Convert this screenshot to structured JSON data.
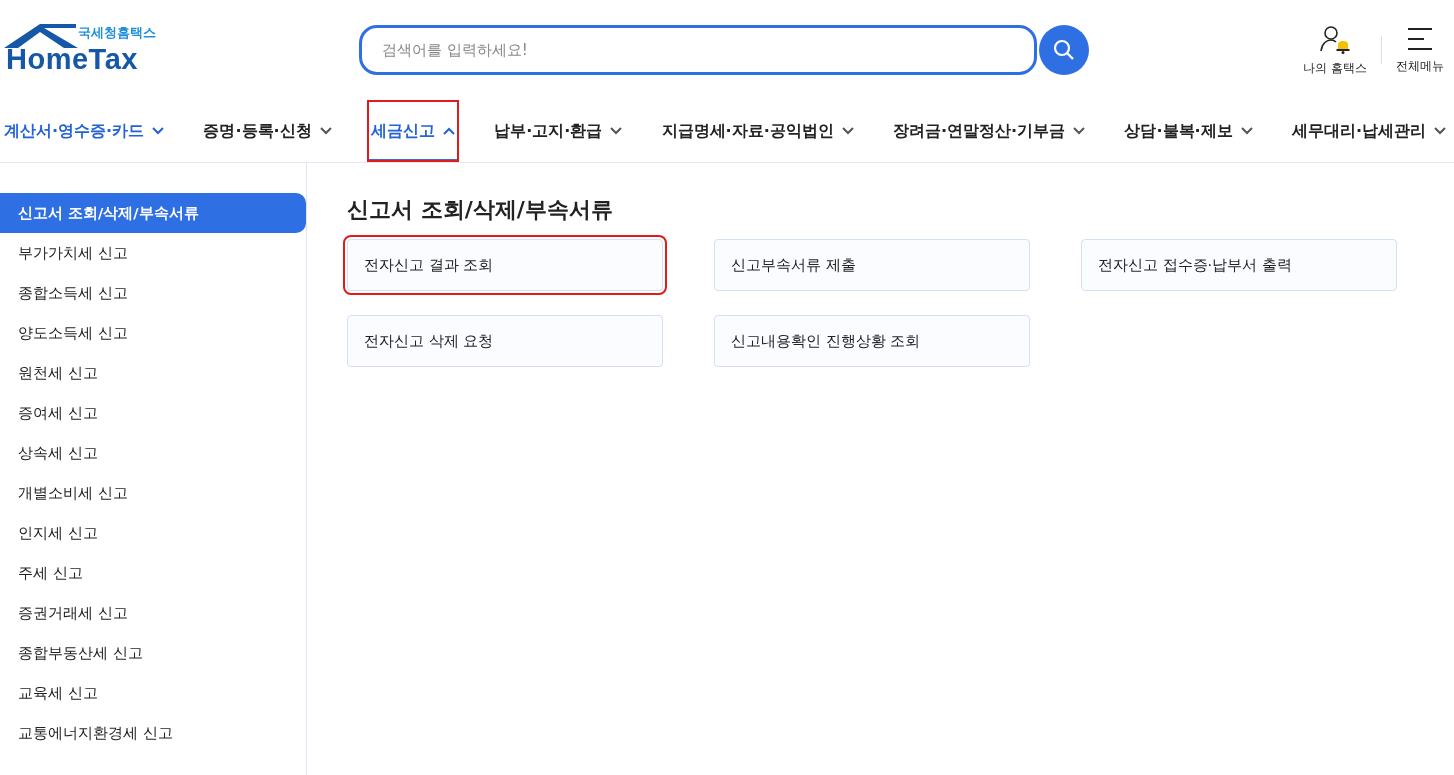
{
  "logo": {
    "subtitle": "국세청홈택스",
    "title": "HomeTax"
  },
  "search": {
    "placeholder": "검색어를 입력하세요!"
  },
  "utility": [
    {
      "kind": "user",
      "label": "나의 홈택스"
    },
    {
      "kind": "menu",
      "label": "전체메뉴"
    }
  ],
  "nav": [
    {
      "label": "계산서·영수증·카드",
      "selected": false,
      "hovered": true,
      "highlighted": false
    },
    {
      "label": "증명·등록·신청",
      "selected": false,
      "hovered": false,
      "highlighted": false
    },
    {
      "label": "세금신고",
      "selected": true,
      "hovered": false,
      "highlighted": true
    },
    {
      "label": "납부·고지·환급",
      "selected": false,
      "hovered": false,
      "highlighted": false
    },
    {
      "label": "지급명세·자료·공익법인",
      "selected": false,
      "hovered": false,
      "highlighted": false
    },
    {
      "label": "장려금·연말정산·기부금",
      "selected": false,
      "hovered": false,
      "highlighted": false
    },
    {
      "label": "상담·불복·제보",
      "selected": false,
      "hovered": false,
      "highlighted": false
    },
    {
      "label": "세무대리·납세관리",
      "selected": false,
      "hovered": false,
      "highlighted": false
    }
  ],
  "sidebar": {
    "items": [
      {
        "label": "신고서 조회/삭제/부속서류",
        "selected": true
      },
      {
        "label": "부가가치세 신고",
        "selected": false
      },
      {
        "label": "종합소득세 신고",
        "selected": false
      },
      {
        "label": "양도소득세 신고",
        "selected": false
      },
      {
        "label": "원천세 신고",
        "selected": false
      },
      {
        "label": "증여세 신고",
        "selected": false
      },
      {
        "label": "상속세 신고",
        "selected": false
      },
      {
        "label": "개별소비세 신고",
        "selected": false
      },
      {
        "label": "인지세 신고",
        "selected": false
      },
      {
        "label": "주세 신고",
        "selected": false
      },
      {
        "label": "증권거래세 신고",
        "selected": false
      },
      {
        "label": "종합부동산세 신고",
        "selected": false
      },
      {
        "label": "교육세 신고",
        "selected": false
      },
      {
        "label": "교통에너지환경세 신고",
        "selected": false
      }
    ]
  },
  "content": {
    "title": "신고서 조회/삭제/부속서류",
    "cards": [
      {
        "label": "전자신고 결과 조회",
        "highlighted": true
      },
      {
        "label": "신고부속서류 제출",
        "highlighted": false
      },
      {
        "label": "전자신고 접수증·납부서 출력",
        "highlighted": false
      },
      {
        "label": "전자신고 삭제 요청",
        "highlighted": false
      },
      {
        "label": "신고내용확인 진행상황 조회",
        "highlighted": false
      }
    ]
  }
}
